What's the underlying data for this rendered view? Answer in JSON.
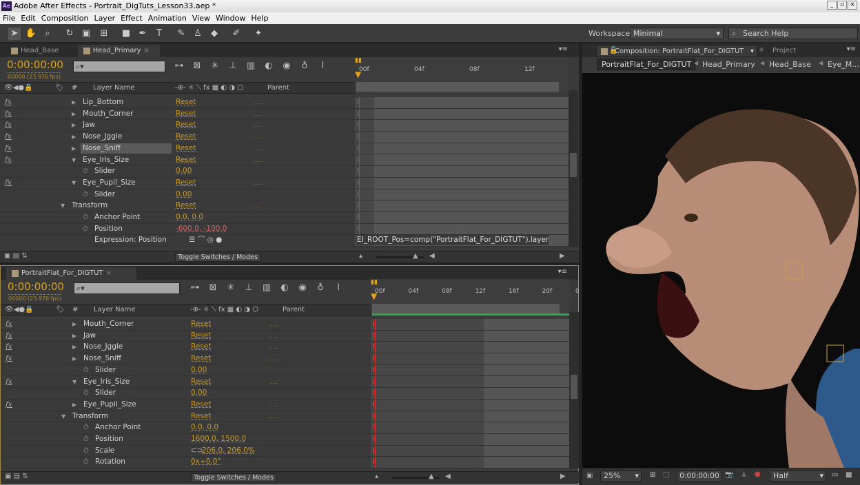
{
  "app": {
    "title": "Adobe After Effects - Portrait_DigTuts_Lesson33.aep *",
    "logo": "Ae"
  },
  "menu": [
    "File",
    "Edit",
    "Composition",
    "Layer",
    "Effect",
    "Animation",
    "View",
    "Window",
    "Help"
  ],
  "toolbar": {
    "workspace_label": "Workspace:",
    "workspace_value": "Minimal",
    "search_placeholder": "Search Help"
  },
  "upper": {
    "tabs": [
      {
        "label": "Head_Base",
        "active": false
      },
      {
        "label": "Head_Primary",
        "active": true
      }
    ],
    "timecode": "0:00:00:00",
    "frames": "00000 (23.976 fps)",
    "columns": {
      "hash": "#",
      "layer_name": "Layer Name",
      "parent": "Parent"
    },
    "ruler": [
      "00f",
      "04f",
      "08f",
      "12f"
    ],
    "rows": [
      {
        "fx": true,
        "twirl": "right",
        "indent": 1,
        "name": "Lip_Bottom",
        "value": "Reset"
      },
      {
        "fx": true,
        "twirl": "right",
        "indent": 1,
        "name": "Mouth_Corner",
        "value": "Reset"
      },
      {
        "fx": true,
        "twirl": "right",
        "indent": 1,
        "name": "Jaw",
        "value": "Reset"
      },
      {
        "fx": true,
        "twirl": "right",
        "indent": 1,
        "name": "Nose_Jggle",
        "value": "Reset"
      },
      {
        "fx": true,
        "twirl": "right",
        "indent": 1,
        "name": "Nose_Sniff",
        "value": "Reset",
        "selected": true
      },
      {
        "fx": true,
        "twirl": "down",
        "indent": 1,
        "name": "Eye_Iris_Size",
        "value": "Reset"
      },
      {
        "fx": false,
        "stopwatch": true,
        "indent": 2,
        "name": "Slider",
        "value": "0.00"
      },
      {
        "fx": true,
        "twirl": "down",
        "indent": 1,
        "name": "Eye_Pupil_Size",
        "value": "Reset"
      },
      {
        "fx": false,
        "stopwatch": true,
        "indent": 2,
        "name": "Slider",
        "value": "0.00"
      },
      {
        "fx": false,
        "twirl": "down",
        "indent": 0,
        "name": "Transform",
        "value": "Reset"
      },
      {
        "fx": false,
        "stopwatch": true,
        "indent": 2,
        "name": "Anchor Point",
        "value": "0.0, 0.0"
      },
      {
        "fx": false,
        "stopwatch": true,
        "indent": 2,
        "name": "Position",
        "value": "-600.0, -100.0",
        "red": true
      },
      {
        "fx": false,
        "indent": 3,
        "name": "Expression: Position",
        "expr": true
      }
    ],
    "expression": "EI_ROOT_Pos=comp(\"PortraitFlat_For_DIGTUT\").layer",
    "toggle": "Toggle Switches / Modes"
  },
  "lower": {
    "tabs": [
      {
        "label": "PortraitFlat_For_DIGTUT",
        "active": true
      }
    ],
    "timecode": "0:00:00:00",
    "frames": "00000 (23.976 fps)",
    "columns": {
      "hash": "#",
      "layer_name": "Layer Name",
      "parent": "Parent"
    },
    "ruler": [
      "00f",
      "04f",
      "08f",
      "12f",
      "16f",
      "20f",
      "0"
    ],
    "rows": [
      {
        "fx": true,
        "twirl": "right",
        "indent": 1,
        "name": "Mouth_Corner",
        "value": "Reset"
      },
      {
        "fx": true,
        "twirl": "right",
        "indent": 1,
        "name": "Jaw",
        "value": "Reset"
      },
      {
        "fx": true,
        "twirl": "right",
        "indent": 1,
        "name": "Nose_Jggle",
        "value": "Reset"
      },
      {
        "fx": true,
        "twirl": "right",
        "indent": 1,
        "name": "Nose_Sniff",
        "value": "Reset"
      },
      {
        "fx": false,
        "stopwatch": true,
        "indent": 2,
        "name": "Slider",
        "value": "0.00"
      },
      {
        "fx": true,
        "twirl": "down",
        "indent": 1,
        "name": "Eye_Iris_Size",
        "value": "Reset"
      },
      {
        "fx": false,
        "stopwatch": true,
        "indent": 2,
        "name": "Slider",
        "value": "0.00"
      },
      {
        "fx": true,
        "twirl": "right",
        "indent": 1,
        "name": "Eye_Pupil_Size",
        "value": "Reset"
      },
      {
        "fx": false,
        "twirl": "down",
        "indent": 0,
        "name": "Transform",
        "value": "Reset"
      },
      {
        "fx": false,
        "stopwatch": true,
        "indent": 2,
        "name": "Anchor Point",
        "value": "0.0, 0.0"
      },
      {
        "fx": false,
        "stopwatch": true,
        "indent": 2,
        "name": "Position",
        "value": "1600.0, 1500.0"
      },
      {
        "fx": false,
        "stopwatch": true,
        "indent": 2,
        "name": "Scale",
        "value": "206.0, 206.0%",
        "link": true
      },
      {
        "fx": false,
        "stopwatch": true,
        "indent": 2,
        "name": "Rotation",
        "value": "0x+0.0°"
      }
    ],
    "toggle": "Toggle Switches / Modes"
  },
  "viewer": {
    "tab": "Composition: PortraitFlat_For_DIGTUT",
    "project_tab": "Project",
    "breadcrumbs": [
      "PortraitFlat_For_DIGTUT",
      "Head_Primary",
      "Head_Base",
      "Eye_M..."
    ],
    "zoom": "25%",
    "timecode": "0:00:00:00",
    "resolution": "Half"
  }
}
